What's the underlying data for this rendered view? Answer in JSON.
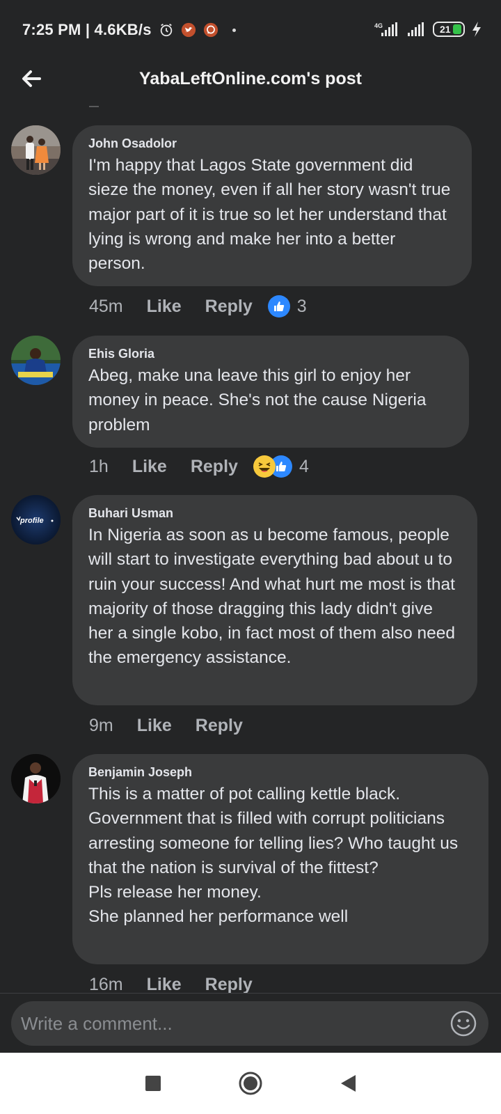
{
  "status_bar": {
    "time": "7:25 PM | 4.6KB/s",
    "network_label": "4G",
    "battery": "21"
  },
  "header": {
    "title": "YabaLeftOnline.com's post"
  },
  "comments": [
    {
      "author": "John Osadolor",
      "text": "I'm happy that Lagos State government did sieze the money, even if all her story wasn't true major part of it is true so let her understand that lying is wrong and make her into a better person.",
      "time": "45m",
      "like_label": "Like",
      "reply_label": "Reply",
      "reaction_count": "3"
    },
    {
      "author": "Ehis Gloria",
      "text": "Abeg, make una leave this girl to enjoy her money in peace. She's not the cause Nigeria problem",
      "time": "1h",
      "like_label": "Like",
      "reply_label": "Reply",
      "reaction_count": "4"
    },
    {
      "author": "Buhari Usman",
      "avatar_text": "profile",
      "text": "In Nigeria as soon as u become famous, people will start to investigate everything bad about u to ruin your success! And what hurt me most is that majority of those dragging this lady didn't give her a single kobo, in fact most of them also need the emergency assistance.",
      "time": "9m",
      "like_label": "Like",
      "reply_label": "Reply"
    },
    {
      "author": "Benjamin Joseph",
      "text": "This is a matter of pot calling kettle black.\nGovernment that is filled with corrupt politicians arresting someone for telling lies? Who taught us that the nation is survival of the fittest?\nPls release her money.\nShe planned her performance well",
      "time": "16m",
      "like_label": "Like",
      "reply_label": "Reply"
    }
  ],
  "composer": {
    "placeholder": "Write a comment..."
  },
  "colors": {
    "background": "#242526",
    "bubble": "#3a3b3c",
    "like_blue": "#2d88ff",
    "haha_yellow": "#f7c93c"
  }
}
